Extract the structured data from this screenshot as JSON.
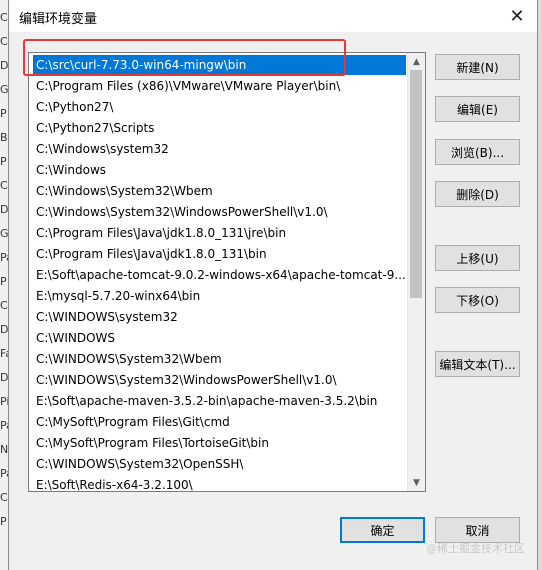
{
  "background": {
    "left_fragments": [
      "C",
      "C",
      "D",
      "G",
      "P",
      "B",
      "P",
      "C",
      "Di",
      "G",
      "Pa",
      "P",
      "C",
      "Di",
      "Fa",
      "D",
      "Pi",
      "Pa",
      "N",
      "Pa",
      "C",
      "P"
    ]
  },
  "dialog": {
    "title": "编辑环境变量",
    "close_glyph": "✕"
  },
  "list": {
    "items": [
      "C:\\src\\curl-7.73.0-win64-mingw\\bin",
      "C:\\Program Files (x86)\\VMware\\VMware Player\\bin\\",
      "C:\\Python27\\",
      "C:\\Python27\\Scripts",
      "C:\\Windows\\system32",
      "C:\\Windows",
      "C:\\Windows\\System32\\Wbem",
      "C:\\Windows\\System32\\WindowsPowerShell\\v1.0\\",
      "C:\\Program Files\\Java\\jdk1.8.0_131\\jre\\bin",
      "C:\\Program Files\\Java\\jdk1.8.0_131\\bin",
      "E:\\Soft\\apache-tomcat-9.0.2-windows-x64\\apache-tomcat-9....",
      "E:\\mysql-5.7.20-winx64\\bin",
      "C:\\WINDOWS\\system32",
      "C:\\WINDOWS",
      "C:\\WINDOWS\\System32\\Wbem",
      "C:\\WINDOWS\\System32\\WindowsPowerShell\\v1.0\\",
      "E:\\Soft\\apache-maven-3.5.2-bin\\apache-maven-3.5.2\\bin",
      "C:\\MySoft\\Program Files\\Git\\cmd",
      "C:\\MySoft\\Program Files\\TortoiseGit\\bin",
      "C:\\WINDOWS\\System32\\OpenSSH\\",
      "E:\\Soft\\Redis-x64-3.2.100\\"
    ],
    "selected_index": 0
  },
  "scrollbar": {
    "up_arrow": "▲",
    "down_arrow": "▼"
  },
  "buttons": {
    "new": "新建(N)",
    "edit": "编辑(E)",
    "browse": "浏览(B)...",
    "delete": "删除(D)",
    "move_up": "上移(U)",
    "move_down": "下移(O)",
    "edit_text": "编辑文本(T)...",
    "ok": "确定",
    "cancel": "取消"
  },
  "colors": {
    "selection": "#0078d7",
    "highlight_box": "#e53935"
  },
  "watermark": "@稀土掘金技术社区"
}
